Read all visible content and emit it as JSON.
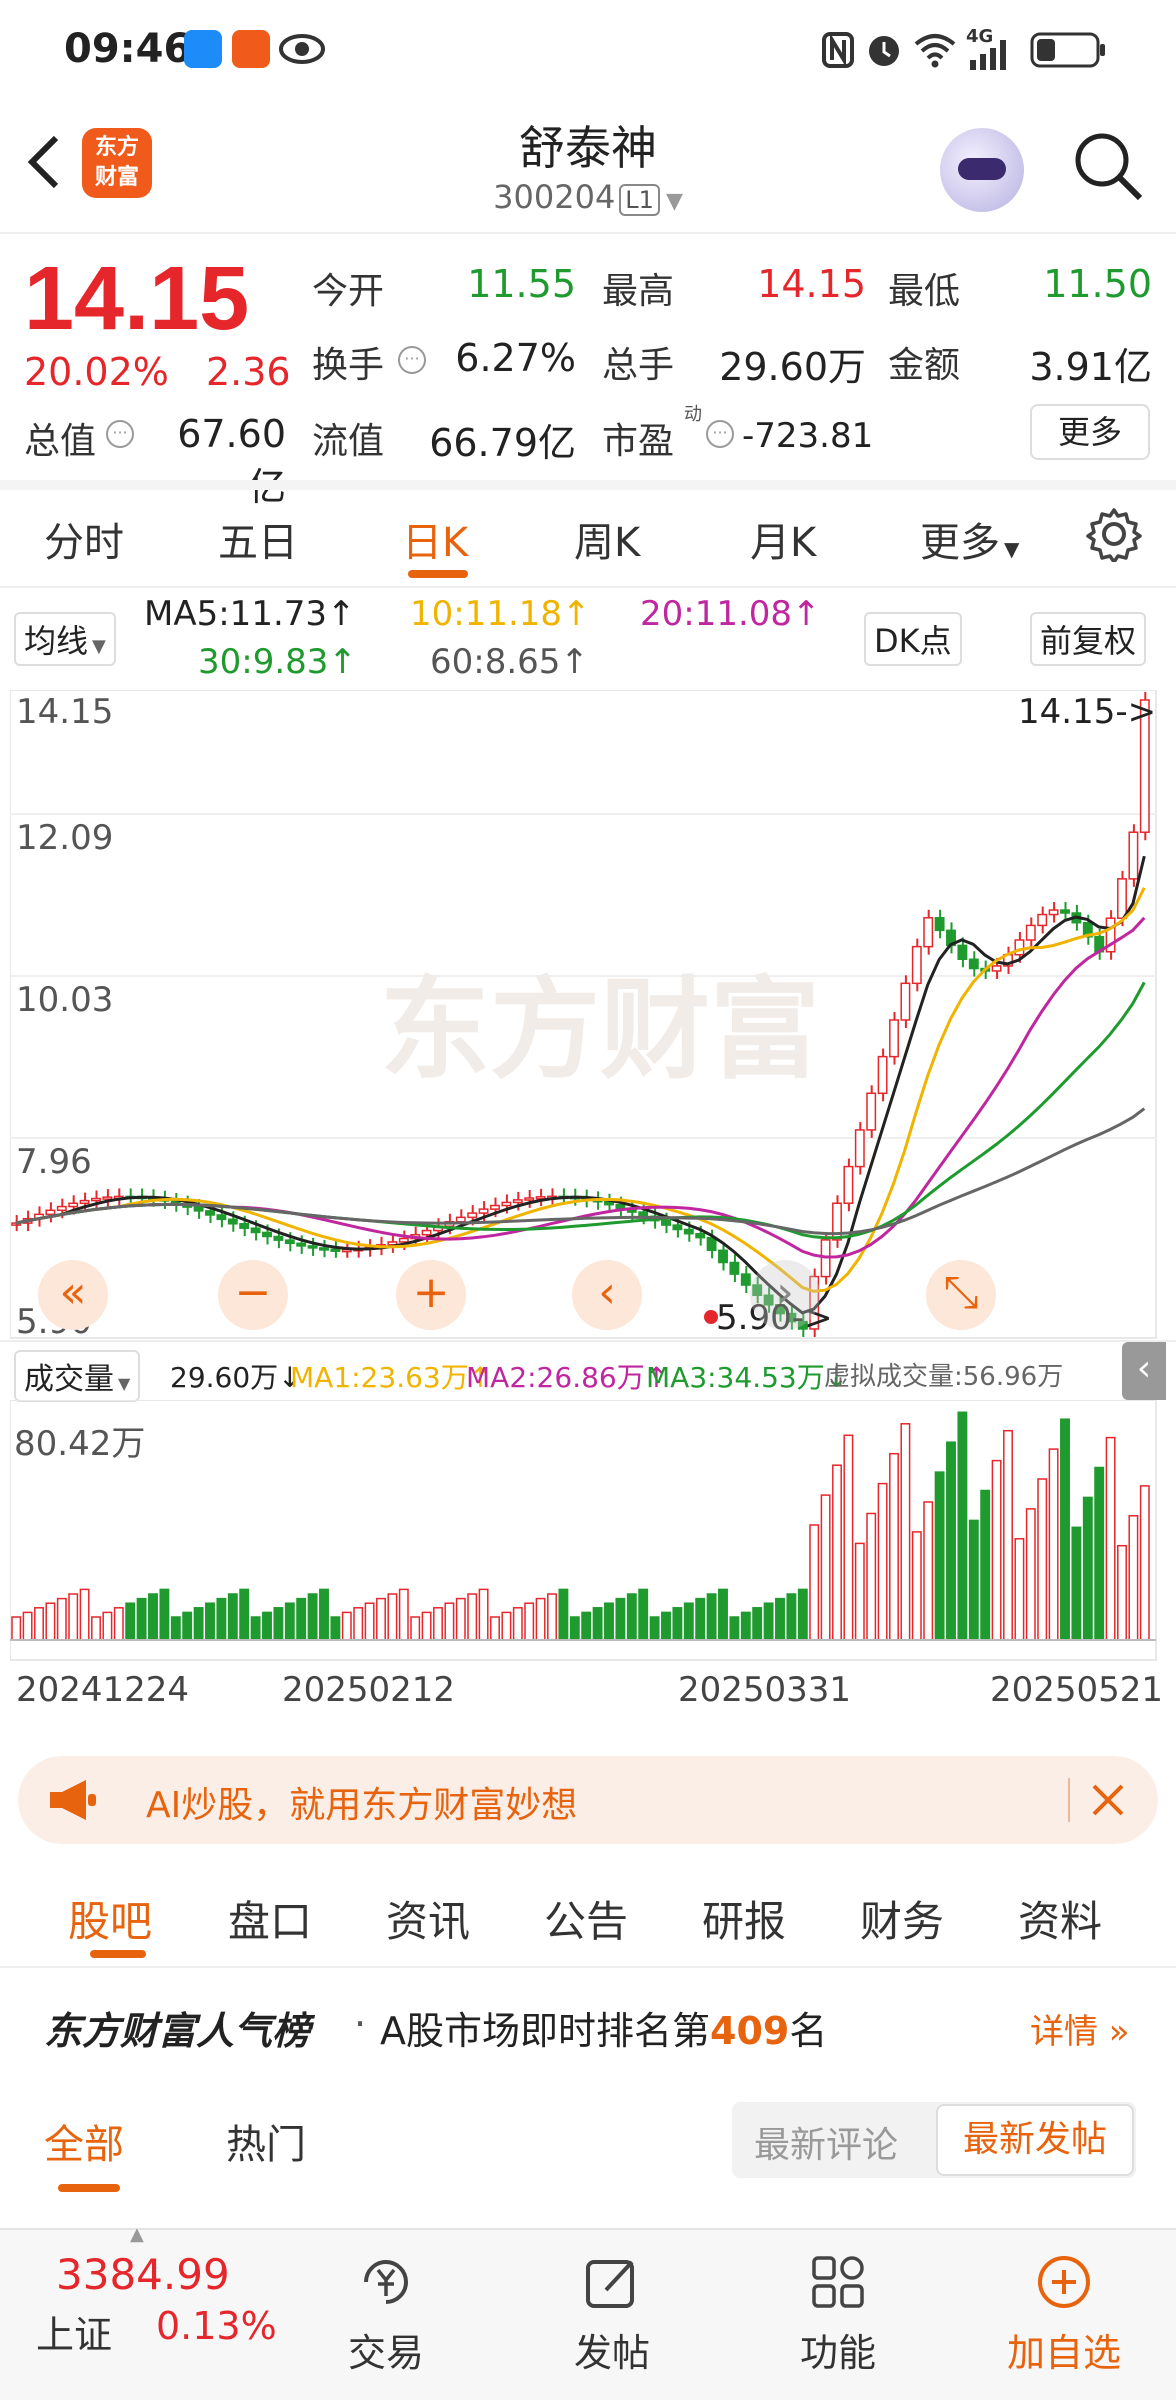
{
  "status_bar": {
    "time": "09:46",
    "battery_icon": "battery-icon",
    "network": "4G"
  },
  "header": {
    "back_icon": "back-arrow-icon",
    "logo_text": "东方财富",
    "stock_name": "舒泰神",
    "stock_code": "300204",
    "level": "L1",
    "search_icon": "search-icon"
  },
  "quote": {
    "price": "14.15",
    "change_pct": "20.02%",
    "change": "2.36",
    "open_label": "今开",
    "open": "11.55",
    "high_label": "最高",
    "high": "14.15",
    "low_label": "最低",
    "low": "11.50",
    "turnover_label": "换手",
    "turnover": "6.27%",
    "volume_label": "总手",
    "volume": "29.60万",
    "amount_label": "金额",
    "amount": "3.91亿",
    "mcap_label": "总值",
    "mcap": "67.60亿",
    "float_label": "流值",
    "float": "66.79亿",
    "pe_label": "市盈",
    "pe_sup": "动",
    "pe": "-723.81",
    "more_button": "更多"
  },
  "period_tabs": {
    "items": [
      "分时",
      "五日",
      "日K",
      "周K",
      "月K",
      "更多"
    ],
    "active": "日K",
    "settings_icon": "gear-icon"
  },
  "ma_bar": {
    "selector": "均线",
    "ma5": "MA5:11.73↑",
    "ma10": "10:11.18↑",
    "ma20": "20:11.08↑",
    "ma30": "30:9.83↑",
    "ma60": "60:8.65↑",
    "dk_button": "DK点",
    "adjust_button": "前复权"
  },
  "kline": {
    "y_labels": [
      "14.15",
      "12.09",
      "10.03",
      "7.96",
      "5.90"
    ],
    "max_marker": "14.15->",
    "min_marker": "5.90->",
    "watermark": "东方财富",
    "controls": [
      "«",
      "−",
      "+",
      "‹",
      "⤡"
    ]
  },
  "volume_bar": {
    "selector": "成交量",
    "vol": "29.60万↓",
    "ma1": "MA1:23.63万↑",
    "ma2": "MA2:26.86万↑",
    "ma3": "MA3:34.53万↓",
    "virtual": "虚拟成交量:56.96万",
    "y_max": "80.42万",
    "dates": [
      "20241224",
      "20250212",
      "20250331",
      "20250521"
    ]
  },
  "banner": {
    "text": "AI炒股，就用东方财富妙想",
    "megaphone_icon": "megaphone-icon",
    "close_icon": "close-icon"
  },
  "content_tabs": {
    "items": [
      "股吧",
      "盘口",
      "资讯",
      "公告",
      "研报",
      "财务",
      "资料"
    ],
    "active": "股吧"
  },
  "rank": {
    "title": "东方财富人气榜",
    "prefix": "A股市场即时排名第",
    "number": "409",
    "suffix": "名",
    "detail": "详情 »"
  },
  "sub_tabs": {
    "all": "全部",
    "hot": "热门",
    "latest_comment": "最新评论",
    "latest_post": "最新发帖"
  },
  "bottom_nav": {
    "index_value": "3384.99",
    "index_name": "上证",
    "index_change": "0.13%",
    "items": [
      {
        "label": "交易",
        "icon": "trade-icon"
      },
      {
        "label": "发帖",
        "icon": "edit-icon"
      },
      {
        "label": "功能",
        "icon": "grid-icon"
      },
      {
        "label": "加自选",
        "icon": "add-circle-icon"
      }
    ]
  },
  "colors": {
    "up": "#e5262a",
    "down": "#1e9a2e",
    "accent": "#e8630e",
    "ma5": "#222222",
    "ma10": "#f0b400",
    "ma20": "#c0269f",
    "ma30": "#1e9a2e",
    "ma60": "#666666"
  }
}
